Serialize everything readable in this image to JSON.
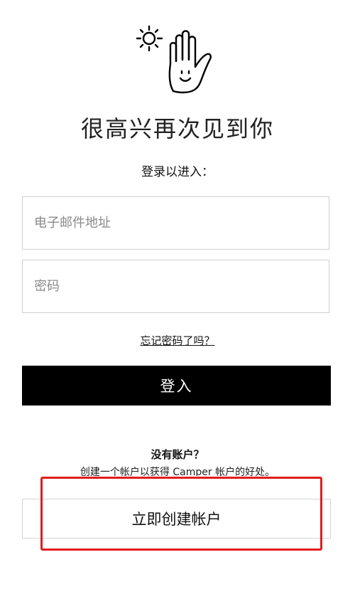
{
  "header": {
    "icon": "sun-and-waving-hand-icon",
    "title": "很高兴再次见到你",
    "subtitle": "登录以进入："
  },
  "form": {
    "email_placeholder": "电子邮件地址",
    "password_placeholder": "密码",
    "forgot_link": "忘记密码了吗？",
    "login_label": "登入"
  },
  "signup": {
    "question": "没有账户？",
    "benefit_text": "创建一个帐户以获得 Camper 帐户的好处。",
    "create_label": "立即创建帐户"
  },
  "colors": {
    "button_bg": "#000000",
    "button_text": "#ffffff",
    "highlight": "#e31c1c",
    "field_border": "#cfcfcf"
  }
}
